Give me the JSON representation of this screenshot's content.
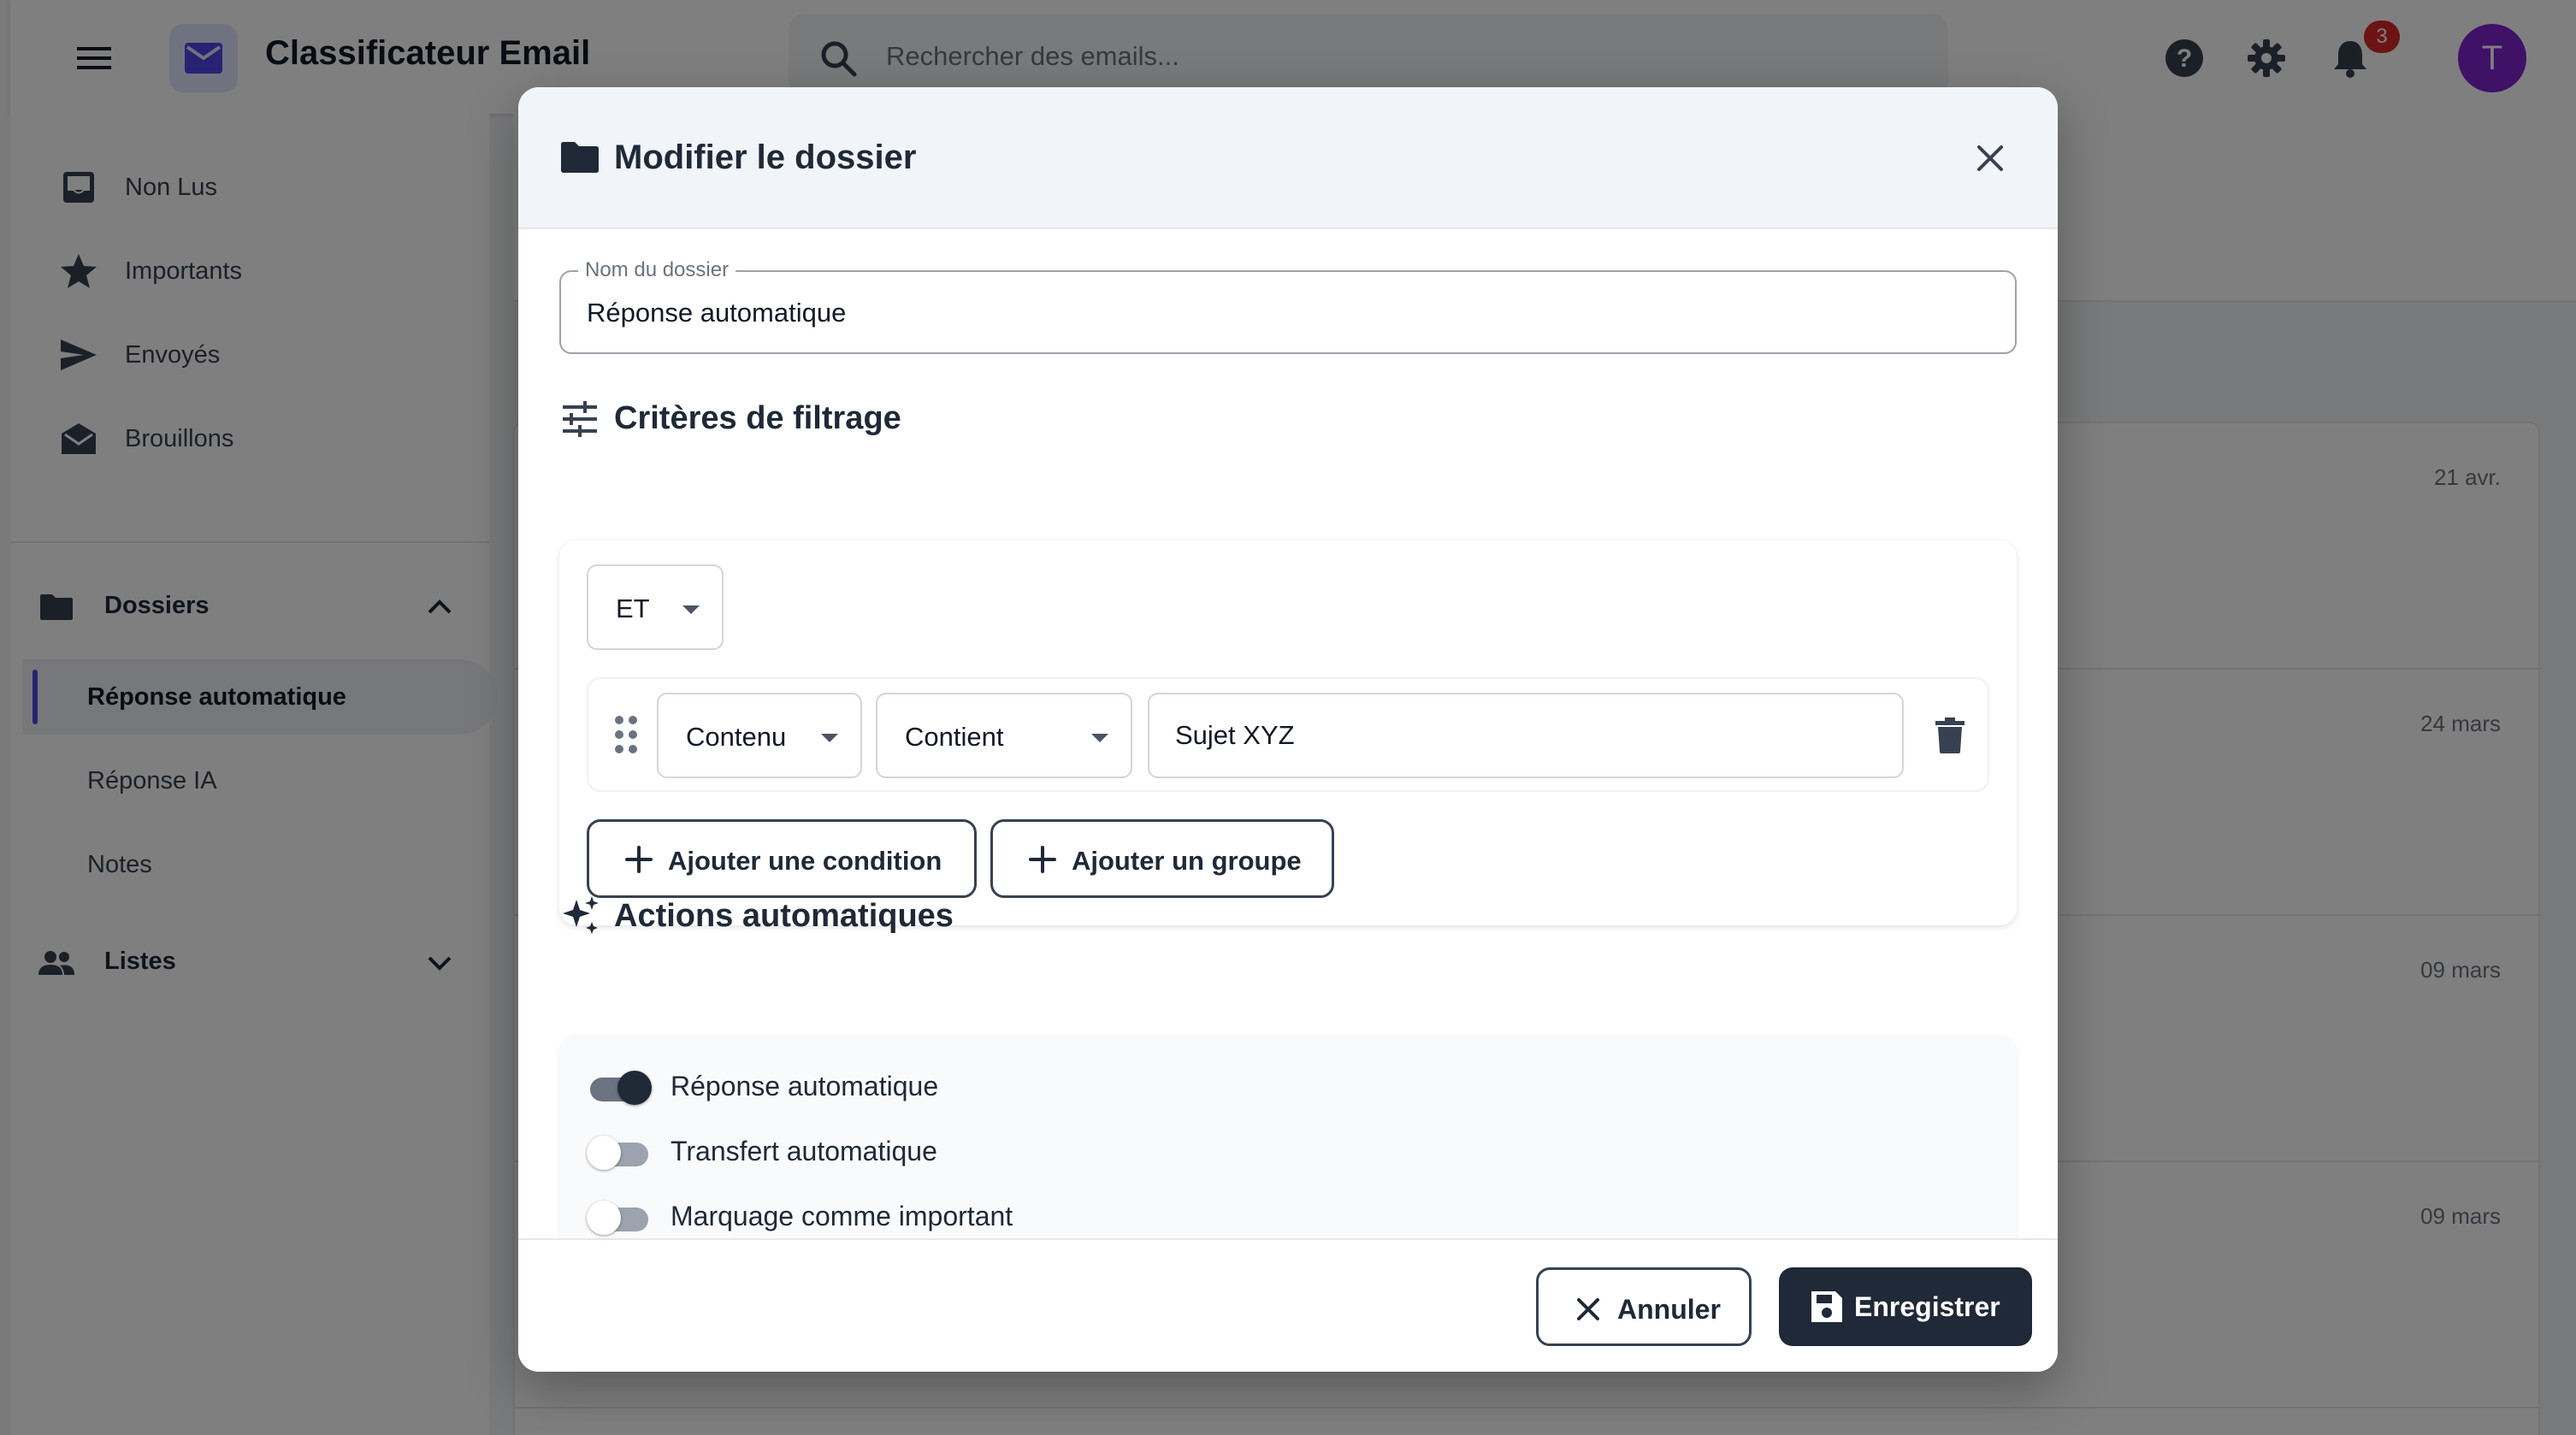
{
  "app": {
    "title": "Classificateur Email",
    "notifications_count": "3",
    "avatar_initial": "T"
  },
  "search": {
    "placeholder": "Rechercher des emails..."
  },
  "icons": {
    "menu": "menu-icon",
    "logo": "mail-icon",
    "search": "search-icon",
    "help": "help-icon",
    "settings": "gear-icon",
    "notifications": "bell-icon"
  },
  "sidebar": {
    "items": [
      {
        "label": "Non Lus",
        "icon": "inbox-icon"
      },
      {
        "label": "Importants",
        "icon": "star-icon"
      },
      {
        "label": "Envoyés",
        "icon": "send-icon"
      },
      {
        "label": "Brouillons",
        "icon": "drafts-icon"
      }
    ],
    "folders": {
      "label": "Dossiers",
      "items": [
        {
          "label": "Réponse automatique",
          "active": true
        },
        {
          "label": "Réponse IA",
          "active": false
        },
        {
          "label": "Notes",
          "active": false
        }
      ]
    },
    "lists": {
      "label": "Listes"
    }
  },
  "emails": {
    "dates": [
      "21 avr.",
      "24 mars",
      "09 mars",
      "09 mars"
    ]
  },
  "modal": {
    "title": "Modifier le dossier",
    "folder_name_label": "Nom du dossier",
    "folder_name_value": "Réponse automatique",
    "filter_title": "Critères de filtrage",
    "operator": "ET",
    "condition": {
      "field": "Contenu",
      "operator": "Contient",
      "value": "Sujet XYZ"
    },
    "add_condition": "Ajouter une condition",
    "add_group": "Ajouter un groupe",
    "actions_title": "Actions automatiques",
    "actions": [
      {
        "label": "Réponse automatique",
        "enabled": true
      },
      {
        "label": "Transfert automatique",
        "enabled": false
      },
      {
        "label": "Marquage comme important",
        "enabled": false
      }
    ],
    "cancel": "Annuler",
    "save": "Enregistrer"
  },
  "colors": {
    "accent": "#4f46e5",
    "primary_button": "#1f2937",
    "badge": "#dc2626",
    "avatar": "#7e22ce"
  }
}
